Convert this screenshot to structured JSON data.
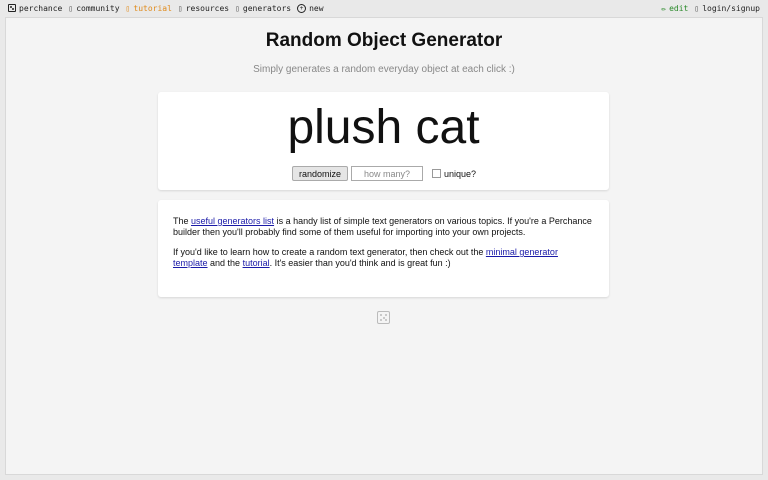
{
  "nav": {
    "left": [
      {
        "label": "perchance",
        "icon": "dice-icon"
      },
      {
        "label": "community",
        "icon": "chat-icon"
      },
      {
        "label": "tutorial",
        "icon": "book-icon"
      },
      {
        "label": "resources",
        "icon": "box-icon"
      },
      {
        "label": "generators",
        "icon": "list-icon"
      },
      {
        "label": "new",
        "icon": "plus-circle-icon"
      }
    ],
    "right": [
      {
        "label": "edit",
        "icon": "pencil-icon"
      },
      {
        "label": "login/signup",
        "icon": "user-icon"
      }
    ]
  },
  "page": {
    "title": "Random Object Generator",
    "subtitle": "Simply generates a random everyday object at each click :)"
  },
  "output": {
    "result": "plush cat",
    "randomize_label": "randomize",
    "count_placeholder": "how many?",
    "unique_label": "unique?"
  },
  "info": {
    "p1_before": "The ",
    "p1_link": "useful generators list",
    "p1_after": " is a handy list of simple text generators on various topics. If you're a Perchance builder then you'll probably find some of them useful for importing into your own projects.",
    "p2_before": "If you'd like to learn how to create a random text generator, then check out the ",
    "p2_link1": "minimal generator template",
    "p2_mid": " and the ",
    "p2_link2": "tutorial",
    "p2_after": ". It's easier than you'd think and is great fun :)"
  },
  "colors": {
    "tutorial": "#e08a1a",
    "edit": "#2a8a2a",
    "link": "#1a1aa8"
  }
}
